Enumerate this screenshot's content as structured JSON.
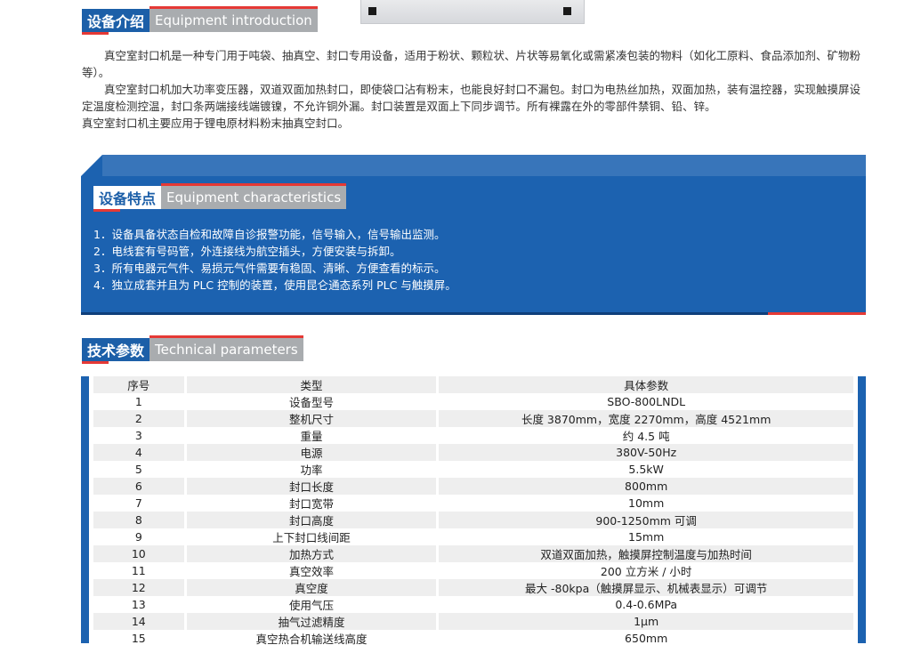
{
  "intro_section": {
    "title_cn": "设备介绍",
    "title_en": "Equipment introduction",
    "paragraphs": [
      "真空室封口机是一种专门用于吨袋、抽真空、封口专用设备，适用于粉状、颗粒状、片状等易氧化或需紧凑包装的物料（如化工原料、食品添加剂、矿物粉等）。",
      "真空室封口机加大功率变压器，双道双面加热封口，即使袋口沾有粉末，也能良好封口不漏包。封口为电热丝加热，双面加热，装有温控器，实现触摸屏设定温度检测控温，封口条两端接线端镀镍，不允许铜外漏。封口装置是双面上下同步调节。所有裸露在外的零部件禁铜、铅、锌。",
      "真空室封口机主要应用于锂电原材料粉末抽真空封口。"
    ]
  },
  "features_section": {
    "title_cn": "设备特点",
    "title_en": "Equipment characteristics",
    "items": [
      "1．设备具备状态自检和故障自诊报警功能，信号输入，信号输出监测。",
      "2．电线套有号码管，外连接线为航空插头，方便安装与拆卸。",
      "3．所有电器元气件、易损元气件需要有稳固、清晰、方便查看的标示。",
      "4．独立成套并且为 PLC 控制的装置，使用昆仑通态系列 PLC 与触摸屏。"
    ]
  },
  "params_section": {
    "title_cn": "技术参数",
    "title_en": "Technical parameters",
    "headers": [
      "序号",
      "类型",
      "具体参数"
    ],
    "rows": [
      [
        "1",
        "设备型号",
        "SBO-800LNDL"
      ],
      [
        "2",
        "整机尺寸",
        "长度 3870mm，宽度 2270mm，高度 4521mm"
      ],
      [
        "3",
        "重量",
        "约 4.5 吨"
      ],
      [
        "4",
        "电源",
        "380V-50Hz"
      ],
      [
        "5",
        "功率",
        "5.5kW"
      ],
      [
        "6",
        "封口长度",
        "800mm"
      ],
      [
        "7",
        "封口宽带",
        "10mm"
      ],
      [
        "8",
        "封口高度",
        "900-1250mm 可调"
      ],
      [
        "9",
        "上下封口线间距",
        "15mm"
      ],
      [
        "10",
        "加热方式",
        "双道双面加热，触摸屏控制温度与加热时间"
      ],
      [
        "11",
        "真空效率",
        "200 立方米 / 小时"
      ],
      [
        "12",
        "真空度",
        "最大 -80kpa（触摸屏显示、机械表显示）可调节"
      ],
      [
        "13",
        "使用气压",
        "0.4-0.6MPa"
      ],
      [
        "14",
        "抽气过滤精度",
        "1μm"
      ],
      [
        "15",
        "真空热合机输送线高度",
        "650mm"
      ]
    ]
  },
  "colors": {
    "brand_blue": "#1c62b0",
    "accent_red": "#e53935",
    "tag_gray": "#a9acaf"
  }
}
